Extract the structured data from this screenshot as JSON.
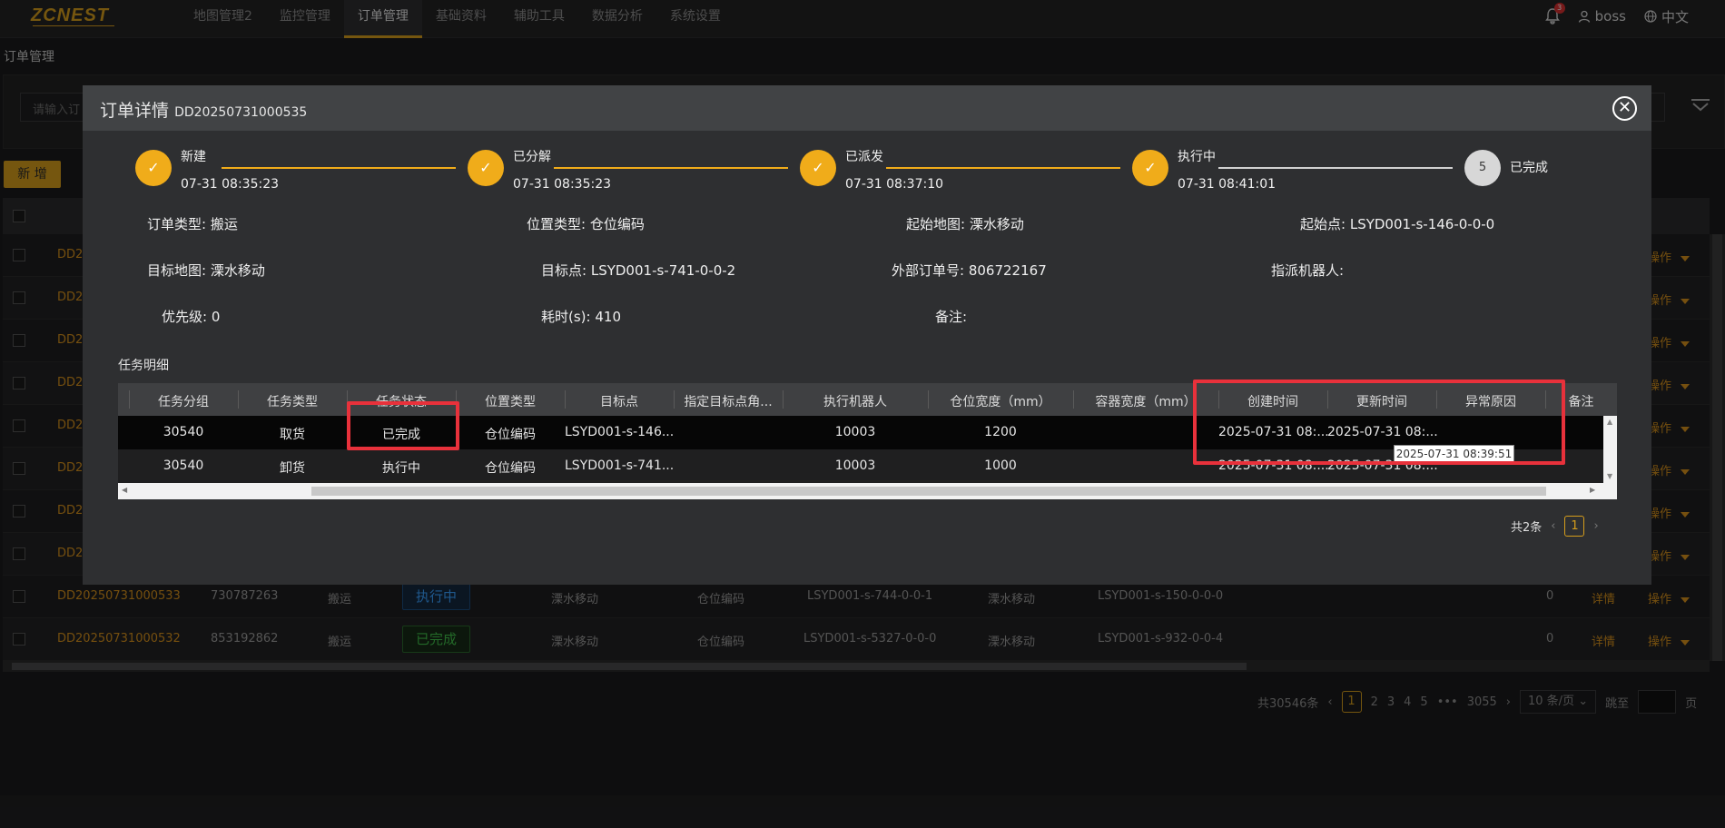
{
  "brand": {
    "logo_text": "ZCNEST",
    "accent": "#d59d1c"
  },
  "nav": {
    "items": [
      {
        "label": "地图管理2"
      },
      {
        "label": "监控管理"
      },
      {
        "label": "订单管理",
        "active": true
      },
      {
        "label": "基础资料"
      },
      {
        "label": "辅助工具"
      },
      {
        "label": "数据分析"
      },
      {
        "label": "系统设置"
      }
    ],
    "notification_badge": "3",
    "user": "boss",
    "language": "中文"
  },
  "page": {
    "title": "订单管理",
    "search_placeholder": "请输入订",
    "new_button": "新 增",
    "rows": [
      {
        "order": "DD2"
      },
      {
        "order": "DD2"
      },
      {
        "order": "DD2"
      },
      {
        "order": "DD2"
      },
      {
        "order": "DD2"
      },
      {
        "order": "DD2"
      },
      {
        "order": "DD2"
      },
      {
        "order": "DD2"
      },
      {
        "order": "DD20250731000533",
        "ext": "730787263",
        "type": "搬运",
        "status": "执行中",
        "start_map": "溧水移动",
        "pos_type": "仓位编码",
        "target": "LSYD001-s-744-0-0-1",
        "map2": "溧水移动",
        "start": "LSYD001-s-150-0-0-0",
        "time": "0",
        "detail": "详情",
        "op": "操作"
      },
      {
        "order": "DD20250731000532",
        "ext": "853192862",
        "type": "搬运",
        "status": "已完成",
        "start_map": "溧水移动",
        "pos_type": "仓位编码",
        "target": "LSYD001-s-5327-0-0-0",
        "map2": "溧水移动",
        "start": "LSYD001-s-932-0-0-4",
        "time": "0",
        "detail": "详情",
        "op": "操作"
      }
    ],
    "op_label": "操作",
    "pager": {
      "total": "共30546条",
      "pages": [
        "1",
        "2",
        "3",
        "4",
        "5",
        "•••",
        "3055"
      ],
      "page_size": "10 条/页",
      "jump": "跳至",
      "jump_unit": "页"
    }
  },
  "modal": {
    "title": "订单详情",
    "order_no": "DD20250731000535",
    "steps": [
      {
        "name": "新建",
        "time": "07-31 08:35:23",
        "done": true
      },
      {
        "name": "已分解",
        "time": "07-31 08:35:23",
        "done": true
      },
      {
        "name": "已派发",
        "time": "07-31 08:37:10",
        "done": true
      },
      {
        "name": "执行中",
        "time": "07-31 08:41:01",
        "done": true
      },
      {
        "name": "已完成",
        "time": "",
        "index": "5",
        "done": false
      }
    ],
    "info": {
      "order_type": {
        "label": "订单类型:",
        "value": "搬运"
      },
      "pos_type": {
        "label": "位置类型:",
        "value": "仓位编码"
      },
      "start_map": {
        "label": "起始地图:",
        "value": "溧水移动"
      },
      "start_point": {
        "label": "起始点:",
        "value": "LSYD001-s-146-0-0-0"
      },
      "target_map": {
        "label": "目标地图:",
        "value": "溧水移动"
      },
      "target_point": {
        "label": "目标点:",
        "value": "LSYD001-s-741-0-0-2"
      },
      "ext_order": {
        "label": "外部订单号:",
        "value": "806722167"
      },
      "robot": {
        "label": "指派机器人:",
        "value": ""
      },
      "priority": {
        "label": "优先级:",
        "value": "0"
      },
      "elapsed": {
        "label": "耗时(s):",
        "value": "410"
      },
      "remark": {
        "label": "备注:",
        "value": ""
      }
    },
    "task_title": "任务明细",
    "task_columns": [
      "任务分组",
      "任务类型",
      "任务状态",
      "位置类型",
      "目标点",
      "指定目标点角...",
      "执行机器人",
      "仓位宽度（mm）",
      "容器宽度（mm）",
      "创建时间",
      "更新时间",
      "异常原因",
      "备注"
    ],
    "tasks": [
      {
        "group": "30540",
        "type": "取货",
        "status": "已完成",
        "pos_type": "仓位编码",
        "target": "LSYD001-s-146...",
        "angle": "",
        "robot": "10003",
        "slot_w": "1200",
        "box_w": "",
        "created": "2025-07-31 08:...",
        "updated": "2025-07-31 08:...",
        "error": "",
        "remark": ""
      },
      {
        "group": "30540",
        "type": "卸货",
        "status": "执行中",
        "pos_type": "仓位编码",
        "target": "LSYD001-s-741...",
        "angle": "",
        "robot": "10003",
        "slot_w": "1000",
        "box_w": "",
        "created": "2025-07-31 08:...",
        "updated": "2025-07-31 08:...",
        "error": "",
        "remark": ""
      }
    ],
    "tooltip": "2025-07-31 08:39:51",
    "pager": {
      "total": "共2条",
      "current": "1"
    }
  }
}
